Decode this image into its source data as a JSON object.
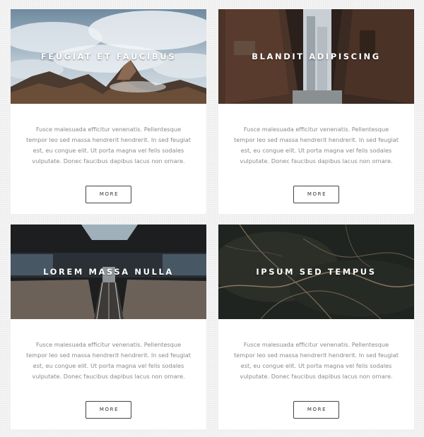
{
  "cards": [
    {
      "title": "FEUGIAT ET FAUCIBUS",
      "image": "mountain-clouds-photo",
      "text": "Fusce malesuada efficitur venenatis. Pellentesque tempor leo sed massa hendrerit hendrerit. In sed feugiat est, eu congue elit. Ut porta magna vel felis sodales vulputate. Donec faucibus dapibus lacus non ornare.",
      "button_label": "MORE"
    },
    {
      "title": "BLANDIT ADIPISCING",
      "image": "city-alley-photo",
      "text": "Fusce malesuada efficitur venenatis. Pellentesque tempor leo sed massa hendrerit hendrerit. In sed feugiat est, eu congue elit. Ut porta magna vel felis sodales vulputate. Donec faucibus dapibus lacus non ornare.",
      "button_label": "MORE"
    },
    {
      "title": "LOREM MASSA NULLA",
      "image": "station-escalator-photo",
      "text": "Fusce malesuada efficitur venenatis. Pellentesque tempor leo sed massa hendrerit hendrerit. In sed feugiat est, eu congue elit. Ut porta magna vel felis sodales vulputate. Donec faucibus dapibus lacus non ornare.",
      "button_label": "MORE"
    },
    {
      "title": "IPSUM SED TEMPUS",
      "image": "aerial-city-lights-photo",
      "text": "Fusce malesuada efficitur venenatis. Pellentesque tempor leo sed massa hendrerit hendrerit. In sed feugiat est, eu congue elit. Ut porta magna vel felis sodales vulputate. Donec faucibus dapibus lacus non ornare.",
      "button_label": "MORE"
    }
  ]
}
